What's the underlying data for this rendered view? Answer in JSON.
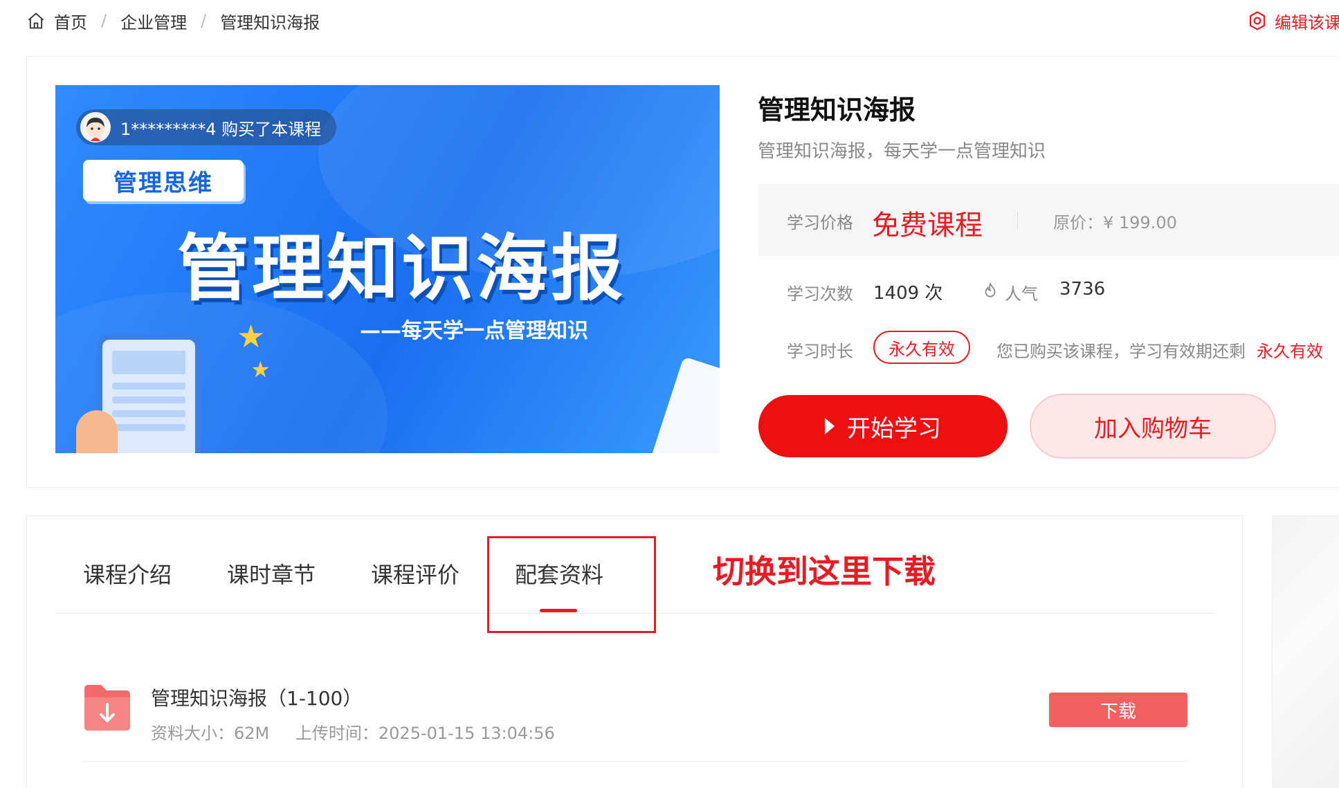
{
  "breadcrumb": {
    "home": "首页",
    "sep": "/",
    "level2": "企业管理",
    "current": "管理知识海报"
  },
  "edit_link": "编辑该课",
  "cover": {
    "buyer_notice": "1*********4 购买了本课程",
    "tag": "管理思维",
    "title": "管理知识海报",
    "subtitle": "——每天学一点管理知识"
  },
  "course": {
    "title": "管理知识海报",
    "subtitle": "管理知识海报，每天学一点管理知识",
    "price_label": "学习价格",
    "price_value": "免费课程",
    "original_price": "原价：¥ 199.00",
    "study_count_label": "学习次数",
    "study_count_value": "1409 次",
    "popularity_label": "人气",
    "popularity_value": "3736",
    "duration_label": "学习时长",
    "duration_pill": "永久有效",
    "validity_text": "您已购买该课程，学习有效期还剩",
    "validity_value": "永久有效",
    "start_button": "开始学习",
    "cart_button": "加入购物车"
  },
  "tabs": [
    {
      "label": "课程介绍"
    },
    {
      "label": "课时章节"
    },
    {
      "label": "课程评价"
    },
    {
      "label": "配套资料",
      "active": true
    }
  ],
  "annotation": "切换到这里下载",
  "materials": [
    {
      "name": "管理知识海报（1-100）",
      "size": "资料大小：62M",
      "upload_time": "上传时间：2025-01-15 13:04:56",
      "download_label": "下载"
    }
  ],
  "colors": {
    "accent": "#e51c23",
    "button_red": "#ee1010",
    "download_red": "#f26060",
    "cover_blue": "#1a6ff0"
  }
}
